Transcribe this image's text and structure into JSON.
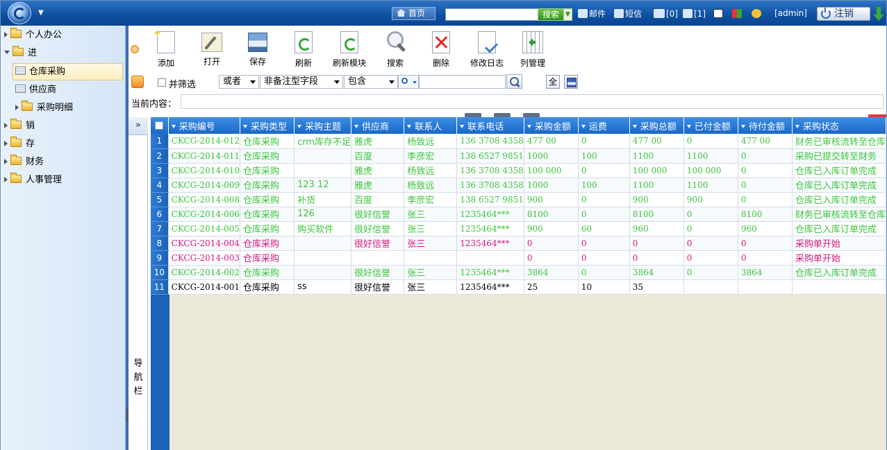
{
  "topbar": {
    "home": "首页",
    "search_button": "搜索",
    "mail": "邮件",
    "sms": "短信",
    "sound_count": "[0]",
    "msg_count": "[1]",
    "user": "[admin]",
    "logout": "注销"
  },
  "sidebar": {
    "items": [
      {
        "label": "个人办公",
        "type": "folder"
      },
      {
        "label": "进",
        "type": "folder"
      },
      {
        "label": "仓库采购",
        "type": "grid"
      },
      {
        "label": "供应商",
        "type": "grid"
      },
      {
        "label": "采购明细",
        "type": "folder"
      },
      {
        "label": "销",
        "type": "folder"
      },
      {
        "label": "存",
        "type": "folder"
      },
      {
        "label": "财务",
        "type": "folder"
      },
      {
        "label": "人事管理",
        "type": "folder"
      }
    ]
  },
  "toolbar": {
    "add": "添加",
    "open": "打开",
    "save": "保存",
    "refresh": "刷新",
    "refresh_module": "刷新模块",
    "search": "搜索",
    "delete": "删除",
    "modify_log": "修改日志",
    "column_manage": "列管理"
  },
  "filter": {
    "and_filter": "并筛选",
    "logic": "或者",
    "field": "非备注型字段",
    "operator": "包含",
    "value": "",
    "all": "全"
  },
  "current": {
    "label": "当前内容：",
    "value": ""
  },
  "navpanel": {
    "expand": "»",
    "title": [
      "导",
      "航",
      "栏"
    ]
  },
  "grid": {
    "columns": [
      "采购编号",
      "采购类型",
      "采购主题",
      "供应商",
      "联系人",
      "联系电话",
      "采购金额",
      "运费",
      "采购总额",
      "已付金额",
      "待付金额",
      "采购状态"
    ],
    "rows": [
      {
        "n": "1",
        "style": "g",
        "c": [
          "CKCG-2014-012",
          "仓库采购",
          "crm库存不足",
          "雅虎",
          "杨致远",
          "136 3708 4358",
          "477 00",
          "0",
          "477 00",
          "0",
          "477 00",
          "财务已审核流转至仓库"
        ]
      },
      {
        "n": "2",
        "style": "g",
        "c": [
          "CKCG-2014-011",
          "仓库采购",
          "",
          "百度",
          "李彦宏",
          "138 6527 9851",
          "1000",
          "100",
          "1100",
          "1100",
          "0",
          "采购已提交转至财务"
        ]
      },
      {
        "n": "3",
        "style": "g",
        "c": [
          "CKCG-2014-010",
          "仓库采购",
          "",
          "雅虎",
          "杨致远",
          "136 3708 4358",
          "100 000",
          "0",
          "100 000",
          "100 000",
          "0",
          "仓库已入库订单完成"
        ]
      },
      {
        "n": "4",
        "style": "g",
        "c": [
          "CKCG-2014-009",
          "仓库采购",
          "123 12",
          "雅虎",
          "杨致远",
          "136 3708 4358",
          "1000",
          "100",
          "1100",
          "1100",
          "0",
          "仓库已入库订单完成"
        ]
      },
      {
        "n": "5",
        "style": "g",
        "c": [
          "CKCG-2014-008",
          "仓库采购",
          "补货",
          "百度",
          "李彦宏",
          "138 6527 9851",
          "900",
          "0",
          "900",
          "900",
          "0",
          "仓库已入库订单完成"
        ]
      },
      {
        "n": "6",
        "style": "g",
        "c": [
          "CKCG-2014-006",
          "仓库采购",
          "126",
          "很好信誉",
          "张三",
          "1235464***",
          "8100",
          "0",
          "8100",
          "0",
          "8100",
          "财务已审核流转至仓库"
        ]
      },
      {
        "n": "7",
        "style": "g",
        "c": [
          "CKCG-2014-005",
          "仓库采购",
          "购买软件",
          "很好信誉",
          "张三",
          "1235464***",
          "900",
          "60",
          "960",
          "0",
          "960",
          "仓库已入库订单完成"
        ]
      },
      {
        "n": "8",
        "style": "p",
        "c": [
          "CKCG-2014-004",
          "仓库采购",
          "",
          "很好信誉",
          "张三",
          "1235464***",
          "0",
          "0",
          "0",
          "0",
          "0",
          "采购单开始"
        ]
      },
      {
        "n": "9",
        "style": "p",
        "c": [
          "CKCG-2014-003",
          "仓库采购",
          "",
          "",
          "",
          "",
          "0",
          "0",
          "0",
          "0",
          "0",
          "采购单开始"
        ]
      },
      {
        "n": "10",
        "style": "g",
        "c": [
          "CKCG-2014-002",
          "仓库采购",
          "",
          "很好信誉",
          "张三",
          "1235464***",
          "3864",
          "0",
          "3864",
          "0",
          "3864",
          "仓库已入库订单完成"
        ]
      },
      {
        "n": "11",
        "style": "k",
        "c": [
          "CKCG-2014-001",
          "仓库采购",
          "ss",
          "很好信誉",
          "张三",
          "1235464***",
          "25",
          "10",
          "35",
          "",
          "",
          ""
        ]
      }
    ]
  }
}
